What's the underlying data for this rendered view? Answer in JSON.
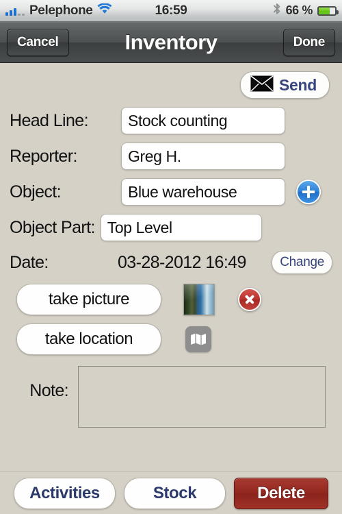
{
  "statusbar": {
    "carrier": "Pelephone",
    "time": "16:59",
    "battery_percent": "66 %",
    "signal_icon": "signal-bars-icon",
    "wifi_icon": "wifi-icon",
    "bluetooth_icon": "bluetooth-icon",
    "battery_icon": "battery-icon",
    "battery_level": 66
  },
  "navbar": {
    "cancel_label": "Cancel",
    "title": "Inventory",
    "done_label": "Done"
  },
  "toolbar": {
    "send_label": "Send",
    "send_icon": "envelope-icon"
  },
  "form": {
    "headline": {
      "label": "Head Line:",
      "value": "Stock counting"
    },
    "reporter": {
      "label": "Reporter:",
      "value": "Greg H."
    },
    "object": {
      "label": "Object:",
      "value": "Blue warehouse",
      "add_icon": "plus-circle-icon"
    },
    "object_part": {
      "label": "Object Part:",
      "value": "Top Level"
    },
    "date": {
      "label": "Date:",
      "value": "03-28-2012 16:49",
      "change_label": "Change"
    },
    "picture": {
      "button_label": "take picture",
      "thumbnail_name": "photo-thumbnail",
      "delete_icon": "delete-circle-icon"
    },
    "location": {
      "button_label": "take location",
      "map_icon": "map-icon"
    },
    "note": {
      "label": "Note:",
      "value": "",
      "placeholder": ""
    }
  },
  "bottombar": {
    "activities_label": "Activities",
    "stock_label": "Stock",
    "delete_label": "Delete"
  },
  "colors": {
    "page_background": "#d5d1c7",
    "navbar": "#4e5151",
    "accent_blue": "#36457e",
    "add_button_blue": "#2f7fd6",
    "delete_red": "#93281f",
    "status_green": "#5fc014"
  }
}
